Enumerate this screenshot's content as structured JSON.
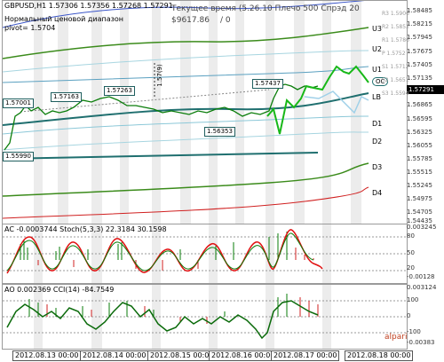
{
  "header": {
    "symbol_line": "GBPUSD,H1  1.57306 1.57356 1.57268 1.57291",
    "pivot_title": "Нормальный ценовой диапазон",
    "pivot_value": "pivot= 1.5704",
    "server_time": "Текущее время (5.26.10 Плечо 500 Спрэд 20",
    "equity": "$9617.86",
    "equity_extra": "/ 0"
  },
  "price_axis": {
    "current_price": "1.57291",
    "ticks": [
      "1.58485",
      "1.58215",
      "1.57945",
      "1.57675",
      "1.57405",
      "1.57135",
      "1.56865",
      "1.56595",
      "1.56325",
      "1.56055",
      "1.55785",
      "1.55515",
      "1.55245",
      "1.54975",
      "1.54705",
      "1.54435"
    ],
    "levels": [
      {
        "label": "U3"
      },
      {
        "label": "U2"
      },
      {
        "label": "U1"
      },
      {
        "label": "OC"
      },
      {
        "label": "LB"
      },
      {
        "label": "D1"
      },
      {
        "label": "D2"
      },
      {
        "label": "D3"
      },
      {
        "label": "D4"
      }
    ],
    "pivot_labels": [
      "R3 1.5906",
      "R2 1.5852",
      "R1 1.5786",
      "P 1.5752",
      "S1 1.5712",
      "S2 1.5651",
      "S3 1.5594"
    ]
  },
  "price_tags": {
    "t1": "1.57163",
    "t2": "1.57263",
    "t3": "1.57437",
    "t4": "1.56353",
    "t5": "1.57001",
    "t6": "1.55990",
    "vertical": "1.57(9)"
  },
  "indicator_ac": {
    "title": "AC -0.0003744  Stoch(5,3,3) 22.3184 30.1598",
    "ticks": [
      "0.003245",
      "80",
      "50",
      "20",
      "-0.00128"
    ]
  },
  "indicator_ao": {
    "title": "AO 0.002369  CCI(14) -84.7549",
    "ticks": [
      "0.003124",
      "100",
      "0",
      "-100",
      "-0.00383"
    ]
  },
  "time_axis": {
    "labels": [
      "2012.08.13 00:00",
      "2012.08.14 00:00",
      "2012.08.15 00:00",
      "2012.08.16 00:00",
      "2012.08.17 00:00",
      "2012.08.18 00:00"
    ]
  },
  "brand": {
    "name": "alpari"
  },
  "colors": {
    "up_candle": "#0a7d0a",
    "down_candle": "#000000",
    "green_line": "#0db10d",
    "stoch_red": "#e01010",
    "teal": "#1f6f6f"
  }
}
